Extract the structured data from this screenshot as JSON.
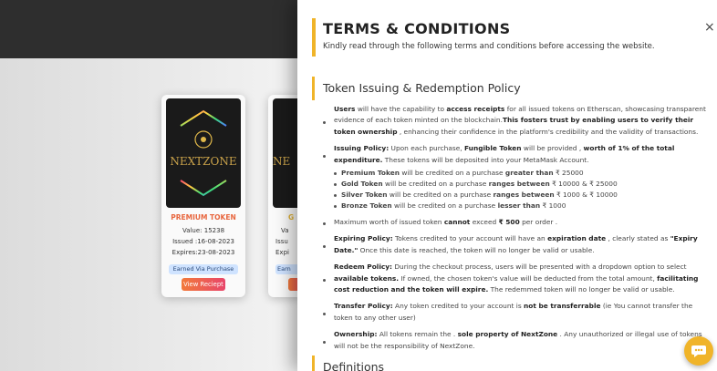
{
  "card": {
    "brand": "NEXTZONE",
    "title": "PREMIUM TOKEN",
    "value": "Value:   15238",
    "issued": "Issued :16-08-2023",
    "expires": "Expires:23-08-2023",
    "badge": "Earned Via Purchase",
    "button": "View Reciept"
  },
  "card2": {
    "brand": "NE",
    "title": "G",
    "value": "Va",
    "issued": "Issu",
    "expires": "Expi",
    "badge": "Earn"
  },
  "panel": {
    "title": "TERMS & CONDITIONS",
    "subtitle": "Kindly read through the following terms and conditions before accessing the website.",
    "close": "×",
    "section1": "Token Issuing & Redemption Policy",
    "section2": "Definitions"
  },
  "terms": {
    "users": {
      "b1": "Users",
      "t1": " will have the capability to ",
      "b2": "access receipts",
      "t2": " for all issued tokens on Etherscan, showcasing transparent evidence of each token minted on the blockchain.",
      "b3": "This fosters trust by enabling users to verify their token ownership",
      "t3": " , enhancing their confidence in the platform's credibility and the validity of transactions."
    },
    "issuing": {
      "b1": "Issuing Policy:",
      "t1": " Upon each purchase, ",
      "b2": "Fungible Token",
      "t2": " will be provided , ",
      "b3": "worth of 1% of the total expenditure.",
      "t3": " These tokens will be deposited into your MetaMask Account."
    },
    "tiers": [
      {
        "name": "Premium Token",
        "mid": " will be credited on a purchase ",
        "cond": "greater than",
        "amount": " ₹ 25000"
      },
      {
        "name": "Gold Token",
        "mid": " will be credited on a purchase ",
        "cond": "ranges between",
        "amount": " ₹ 10000 & ₹ 25000"
      },
      {
        "name": "Silver Token",
        "mid": " will be credited on a purchase ",
        "cond": "ranges between",
        "amount": " ₹ 1000 & ₹ 10000"
      },
      {
        "name": "Bronze Token",
        "mid": " will be credited on a purchase ",
        "cond": "lesser than",
        "amount": " ₹ 1000"
      }
    ],
    "max": {
      "t1": "Maximum worth of issued token ",
      "b1": "cannot",
      "t2": " exceed ",
      "b2": "₹ 500",
      "t3": " per order ."
    },
    "expiring": {
      "b1": "Expiring Policy:",
      "t1": " Tokens credited to your account will have an ",
      "b2": "expiration date",
      "t2": " , clearly stated as ",
      "b3": "\"Expiry Date.\"",
      "t3": " Once this date is reached, the token will no longer be valid or usable."
    },
    "redeem": {
      "b1": "Redeem Policy:",
      "t1": " During the checkout process, users will be presented with a dropdown option to select ",
      "b2": "available tokens.",
      "t2": " If owned, the chosen token's value will be deducted from the total amount, ",
      "b3": "facilitating cost reduction and the token will expire.",
      "t3": " The redemmed token will no longer be valid or usable."
    },
    "transfer": {
      "b1": "Transfer Policy:",
      "t1": " Any token credited to your account is ",
      "b2": "not be transferrable",
      "t2": " (ie You cannot transfer the token to any other user)"
    },
    "ownership": {
      "b1": "Ownership:",
      "t1": " All tokens remain the . ",
      "b2": "sole property of NextZone",
      "t2": " . Any unauthorized or illegal use of tokens will not be the responsibility of NextZone."
    }
  },
  "icons": {
    "close": "close-icon",
    "chat": "chat-icon"
  },
  "colors": {
    "accent": "#f0b429",
    "topbar": "#2e2e2e",
    "card_title": "#e8663e"
  }
}
